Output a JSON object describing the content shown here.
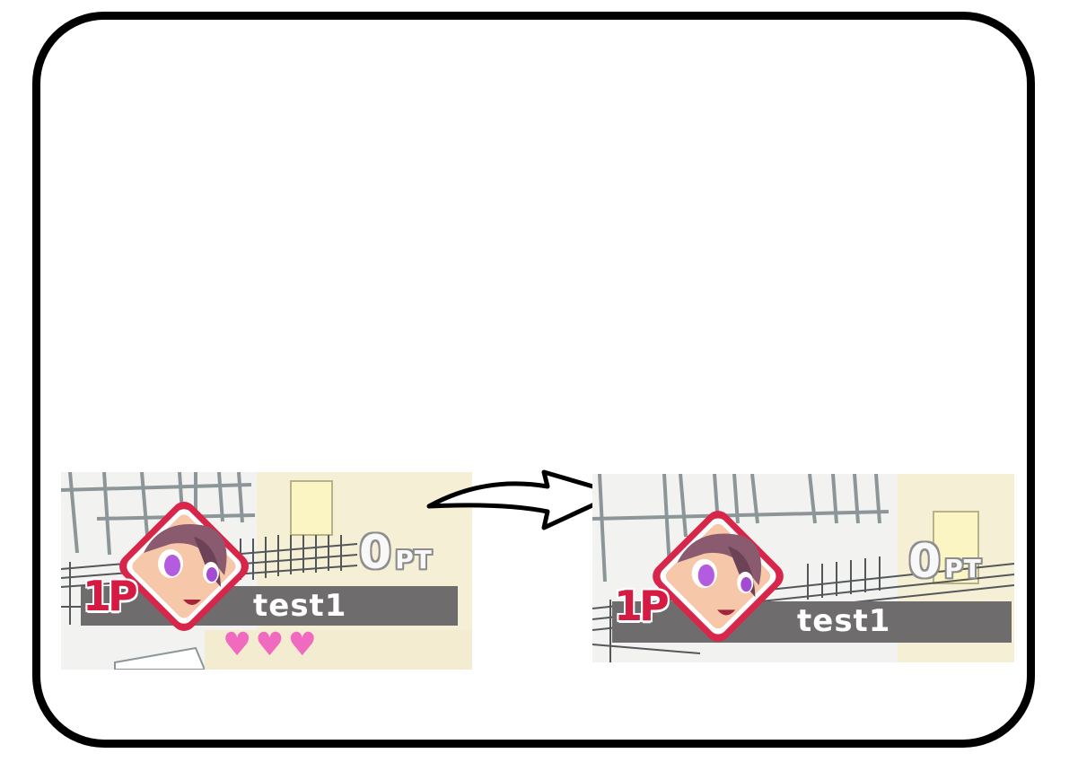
{
  "before": {
    "player_tag": "1P",
    "player_name": "test1",
    "score_value": "0",
    "score_unit": "PT",
    "hearts": 3,
    "heart_glyph": "♥"
  },
  "after": {
    "player_tag": "1P",
    "player_name": "test1",
    "score_value": "0",
    "score_unit": "PT"
  },
  "colors": {
    "tag_red": "#d51b42",
    "namebar_gray": "#6e6c6c",
    "heart_pink": "#f06ac0"
  },
  "icons": {
    "transition_arrow": "arrow-right-icon",
    "avatar": "character-portrait-icon",
    "heart": "heart-icon"
  }
}
